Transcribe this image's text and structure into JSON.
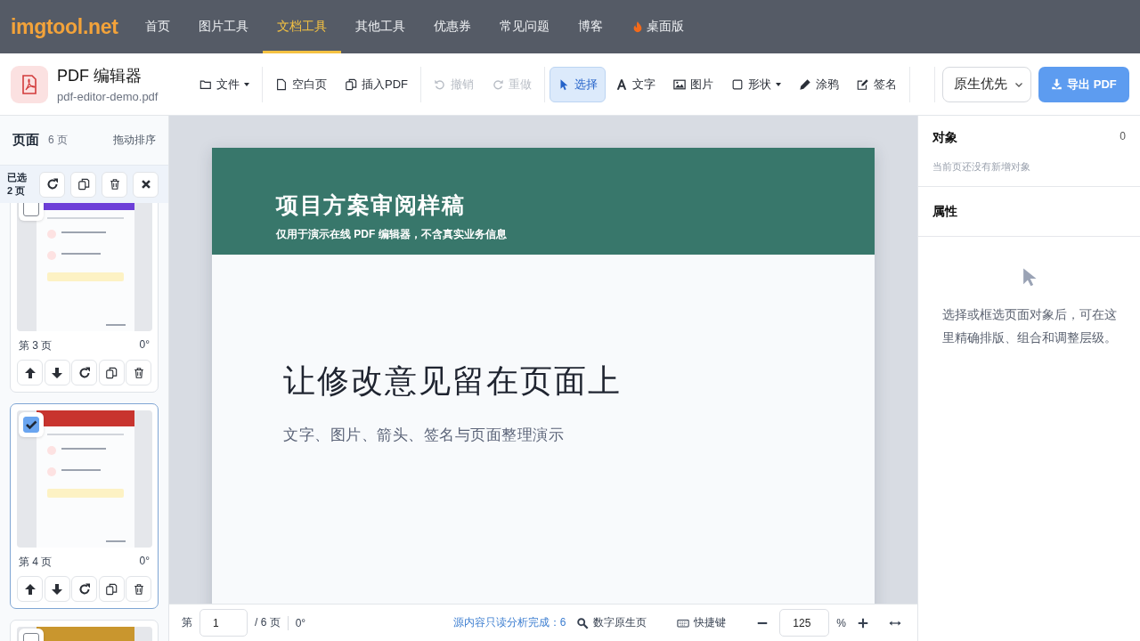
{
  "nav": {
    "logo": "imgtool.net",
    "items": [
      {
        "label": "首页",
        "selected": false,
        "flame": false
      },
      {
        "label": "图片工具",
        "selected": false,
        "flame": false
      },
      {
        "label": "文档工具",
        "selected": true,
        "flame": false
      },
      {
        "label": "其他工具",
        "selected": false,
        "flame": false
      },
      {
        "label": "优惠券",
        "selected": false,
        "flame": false
      },
      {
        "label": "常见问题",
        "selected": false,
        "flame": false
      },
      {
        "label": "博客",
        "selected": false,
        "flame": false
      },
      {
        "label": "桌面版",
        "selected": false,
        "flame": true
      }
    ]
  },
  "toolbar": {
    "title": "PDF 编辑器",
    "filename": "pdf-editor-demo.pdf",
    "groups": [
      [
        {
          "label": "文件",
          "dropdown": true,
          "disabled": false,
          "selected": false
        }
      ],
      [
        {
          "label": "空白页",
          "dropdown": false,
          "disabled": false,
          "selected": false
        },
        {
          "label": "插入PDF",
          "dropdown": false,
          "disabled": false,
          "selected": false
        }
      ],
      [
        {
          "label": "撤销",
          "dropdown": false,
          "disabled": true,
          "selected": false
        },
        {
          "label": "重做",
          "dropdown": false,
          "disabled": true,
          "selected": false
        }
      ],
      [
        {
          "label": "选择",
          "dropdown": false,
          "disabled": false,
          "selected": true
        },
        {
          "label": "文字",
          "dropdown": false,
          "disabled": false,
          "selected": false
        },
        {
          "label": "图片",
          "dropdown": false,
          "disabled": false,
          "selected": false
        },
        {
          "label": "形状",
          "dropdown": true,
          "disabled": false,
          "selected": false
        },
        {
          "label": "涂鸦",
          "dropdown": false,
          "disabled": false,
          "selected": false
        },
        {
          "label": "签名",
          "dropdown": false,
          "disabled": false,
          "selected": false
        }
      ]
    ],
    "mode": "原生优先",
    "export": "导出 PDF"
  },
  "sidebar": {
    "title": "页面",
    "count": "6 页",
    "hint": "拖动排序",
    "selection": [
      "已选",
      "2 页"
    ],
    "pages": [
      {
        "label": "第 3 页",
        "rotation": "0°",
        "checked": false,
        "color": "#6d3fd8"
      },
      {
        "label": "第 4 页",
        "rotation": "0°",
        "checked": true,
        "color": "#c8342e"
      },
      {
        "checked": false,
        "color": "#c9962e"
      }
    ]
  },
  "document": {
    "header_title": "项目方案审阅样稿",
    "header_subtitle": "仅用于演示在线 PDF 编辑器，不含真实业务信息",
    "heading": "让修改意见留在页面上",
    "subheading": "文字、图片、箭头、签名与页面整理演示"
  },
  "status_bar": {
    "page_prefix": "第",
    "page": "1",
    "page_total": "/ 6 页",
    "rotation": "0°",
    "analysis": "源内容只读分析完成：6",
    "page_type": "数字原生页",
    "shortcuts": "快捷键",
    "zoom": "125",
    "zoom_unit": "%"
  },
  "objects": {
    "title": "对象",
    "count": "0",
    "empty": "当前页还没有新增对象"
  },
  "properties": {
    "title": "属性",
    "empty": "选择或框选页面对象后，可在这里精确排版、组合和调整层级。"
  }
}
